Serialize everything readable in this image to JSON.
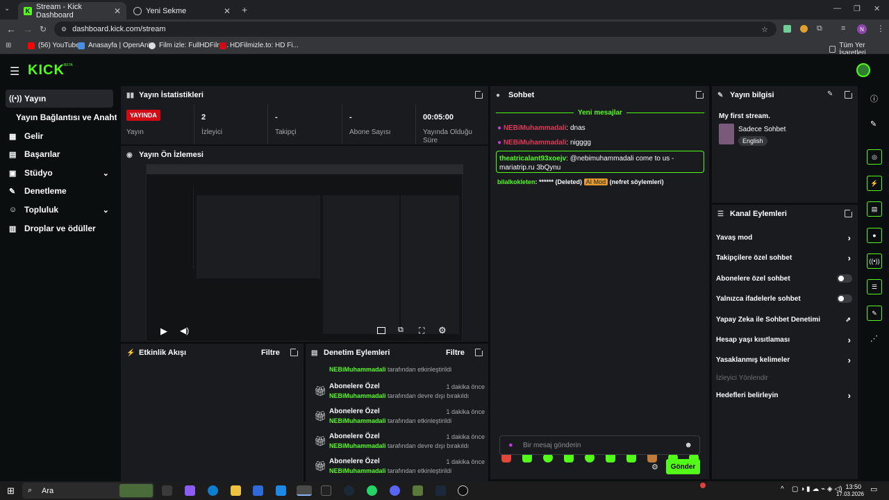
{
  "browser": {
    "tabs": [
      {
        "title": "Stream - Kick Dashboard",
        "active": true
      },
      {
        "title": "Yeni Sekme",
        "active": false
      }
    ],
    "url": "dashboard.kick.com/stream",
    "bookmarks": [
      "(56) YouTube",
      "Anasayfa | OpenAni...",
      "Film izle: FullHDFilm...",
      "HDFilmizle.to: HD Fi..."
    ],
    "bookmarks_all": "Tüm Yer İşaretleri",
    "profile_initial": "N"
  },
  "brand": {
    "logo": "KICK",
    "beta": "BETA",
    "accent": "#53fc18"
  },
  "sidebar": {
    "items": [
      {
        "label": "Yayın"
      },
      {
        "label": "Yayın Bağlantısı ve Anahtarı"
      },
      {
        "label": "Gelir"
      },
      {
        "label": "Başarılar"
      },
      {
        "label": "Stüdyo"
      },
      {
        "label": "Denetleme"
      },
      {
        "label": "Topluluk"
      },
      {
        "label": "Droplar ve ödüller"
      }
    ]
  },
  "stats": {
    "title": "Yayın İstatistikleri",
    "live_badge": "YAYINDA",
    "status_label": "Yayın",
    "cells": [
      {
        "value": "2",
        "label": "İzleyici"
      },
      {
        "value": "-",
        "label": "Takipçi"
      },
      {
        "value": "-",
        "label": "Abone Sayısı"
      },
      {
        "value": "00:05:00",
        "label": "Yayında Olduğu Süre"
      }
    ]
  },
  "preview": {
    "title": "Yayın Ön İzlemesi"
  },
  "activity": {
    "title": "Etkinlik Akışı",
    "filter": "Filtre"
  },
  "moderation": {
    "title": "Denetim Eylemleri",
    "filter": "Filtre",
    "first_sub": {
      "user": "NEBiMuhammadali",
      "text": "tarafından etkinleştirildi"
    },
    "rows": [
      {
        "title": "Abonelere Özel",
        "user": "NEBiMuhammadali",
        "text": "tarafından devre dışı bırakıldı",
        "time": "1 dakika önce"
      },
      {
        "title": "Abonelere Özel",
        "user": "NEBiMuhammadali",
        "text": "tarafından etkinleştirildi",
        "time": "1 dakika önce"
      },
      {
        "title": "Abonelere Özel",
        "user": "NEBiMuhammadali",
        "text": "tarafından devre dışı bırakıldı",
        "time": "1 dakika önce"
      },
      {
        "title": "Abonelere Özel",
        "user": "NEBiMuhammadali",
        "text": "tarafından etkinleştirildi",
        "time": "1 dakika önce"
      }
    ]
  },
  "chat": {
    "title": "Sohbet",
    "new_messages": "Yeni mesajlar",
    "messages": [
      {
        "user": "NEBiMuhammadali",
        "text": ": dnas"
      },
      {
        "user": "NEBiMuhammadali",
        "text": ": nigggg"
      },
      {
        "user": "theatricalant93xoejv",
        "text": ": @nebimuhammadali come to us - mariatrip.ru 3bQynu"
      },
      {
        "user": "bilalkokleten",
        "text": ": ****** (Deleted)",
        "badge": "AI Mod",
        "suffix": "(nefret söylemleri)"
      }
    ],
    "input_placeholder": "Bir mesaj gönderin",
    "send_label": "Gönder"
  },
  "stream_info": {
    "title": "Yayın bilgisi",
    "stream_title": "My first stream.",
    "category": "Sadece Sohbet",
    "language": "English"
  },
  "channel_actions": {
    "title": "Kanal Eylemleri",
    "items": [
      {
        "label": "Yavaş mod",
        "kind": "arrow"
      },
      {
        "label": "Takipçilere özel sohbet",
        "kind": "arrow"
      },
      {
        "label": "Abonelere özel sohbet",
        "kind": "toggle"
      },
      {
        "label": "Yalnızca ifadelerle sohbet",
        "kind": "toggle"
      },
      {
        "label": "Yapay Zeka ile Sohbet Denetimi",
        "kind": "external"
      },
      {
        "label": "Hesap yaşı kısıtlaması",
        "kind": "arrow"
      },
      {
        "label": "Yasaklanmış kelimeler",
        "kind": "arrow"
      },
      {
        "label": "İzleyici Yönlendir",
        "kind": "disabled"
      },
      {
        "label": "Hedefleri belirleyin",
        "kind": "arrow"
      }
    ]
  },
  "taskbar": {
    "search": "Ara",
    "time": "13:50",
    "date": "17.03.2026"
  }
}
